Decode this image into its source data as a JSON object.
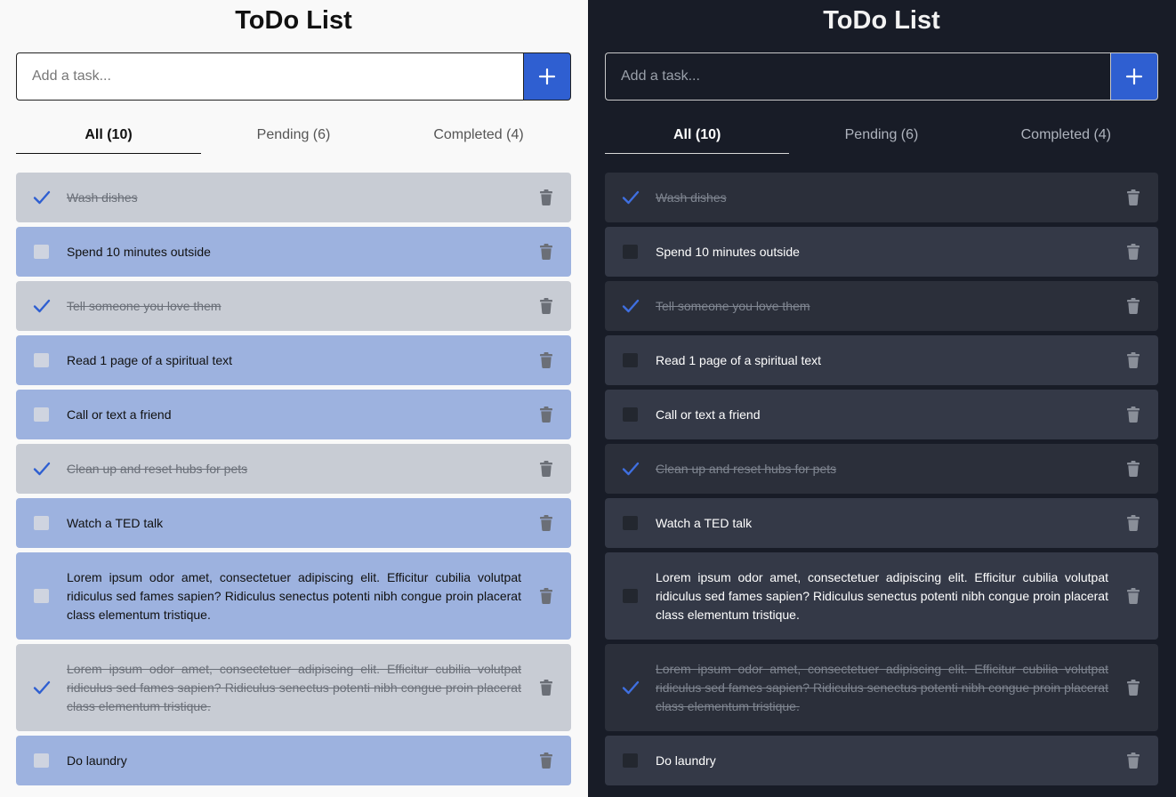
{
  "light": {
    "title": "ToDo List",
    "add_placeholder": "Add a task...",
    "tabs": [
      {
        "label": "All (10)",
        "active": true
      },
      {
        "label": "Pending (6)",
        "active": false
      },
      {
        "label": "Completed (4)",
        "active": false
      }
    ],
    "tasks": [
      {
        "text": "Wash dishes",
        "done": true
      },
      {
        "text": "Spend 10 minutes outside",
        "done": false
      },
      {
        "text": "Tell someone you love them",
        "done": true
      },
      {
        "text": "Read 1 page of a spiritual text",
        "done": false
      },
      {
        "text": "Call or text a friend",
        "done": false
      },
      {
        "text": "Clean up and reset hubs for pets",
        "done": true
      },
      {
        "text": "Watch a TED talk",
        "done": false
      },
      {
        "text": "Lorem ipsum odor amet, consectetuer adipiscing elit. Efficitur cubilia volutpat ridiculus sed fames sapien? Ridiculus senectus potenti nibh congue proin placerat class elementum tristique.",
        "done": false
      },
      {
        "text": "Lorem ipsum odor amet, consectetuer adipiscing elit. Efficitur cubilia volutpat ridiculus sed fames sapien? Ridiculus senectus potenti nibh congue proin placerat class elementum tristique.",
        "done": true
      },
      {
        "text": "Do laundry",
        "done": false
      }
    ]
  },
  "dark": {
    "title": "ToDo List",
    "add_placeholder": "Add a task...",
    "tabs": [
      {
        "label": "All (10)",
        "active": true
      },
      {
        "label": "Pending (6)",
        "active": false
      },
      {
        "label": "Completed (4)",
        "active": false
      }
    ],
    "tasks": [
      {
        "text": "Wash dishes",
        "done": true
      },
      {
        "text": "Spend 10 minutes outside",
        "done": false
      },
      {
        "text": "Tell someone you love them",
        "done": true
      },
      {
        "text": "Read 1 page of a spiritual text",
        "done": false
      },
      {
        "text": "Call or text a friend",
        "done": false
      },
      {
        "text": "Clean up and reset hubs for pets",
        "done": true
      },
      {
        "text": "Watch a TED talk",
        "done": false
      },
      {
        "text": "Lorem ipsum odor amet, consectetuer adipiscing elit. Efficitur cubilia volutpat ridiculus sed fames sapien? Ridiculus senectus potenti nibh congue proin placerat class elementum tristique.",
        "done": false
      },
      {
        "text": "Lorem ipsum odor amet, consectetuer adipiscing elit. Efficitur cubilia volutpat ridiculus sed fames sapien? Ridiculus senectus potenti nibh congue proin placerat class elementum tristique.",
        "done": true
      },
      {
        "text": "Do laundry",
        "done": false
      }
    ]
  },
  "icons": {
    "add": "plus-icon",
    "check": "checkmark-icon",
    "delete": "trash-icon"
  },
  "colors": {
    "accent": "#2f5fd1",
    "light_pending": "#9db2df",
    "light_done": "#c8ccd4",
    "dark_background": "#181c27",
    "dark_pending": "#343947",
    "dark_done": "#2b2f3a"
  }
}
